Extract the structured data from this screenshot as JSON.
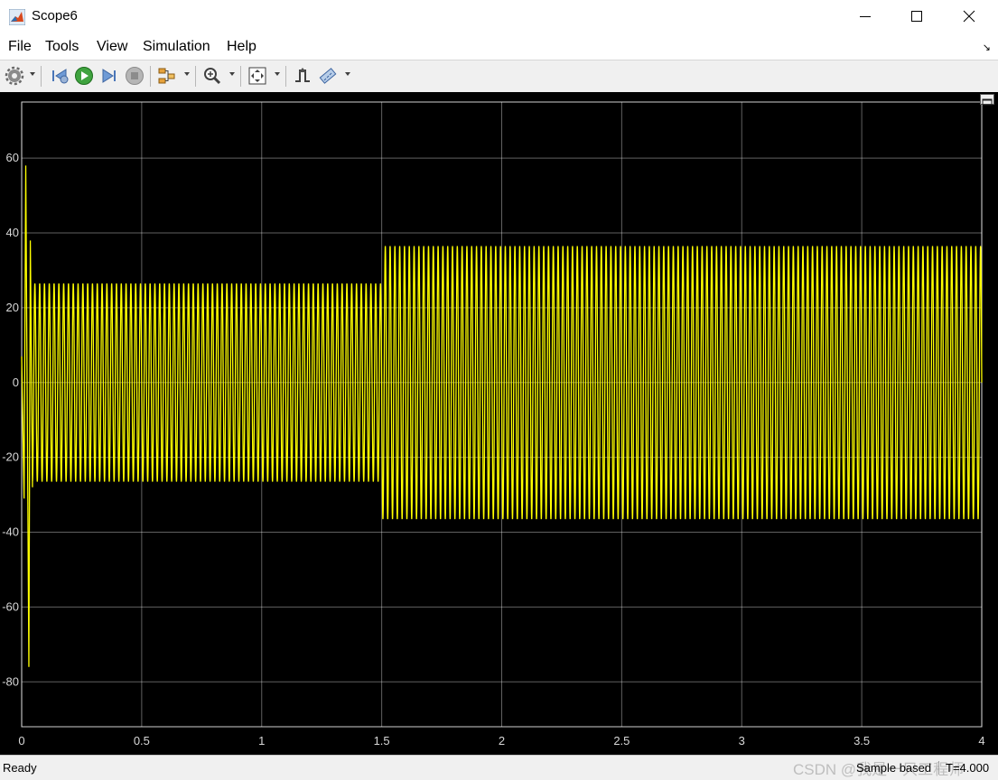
{
  "window": {
    "title": "Scope6"
  },
  "menu": [
    "File",
    "Tools",
    "View",
    "Simulation",
    "Help"
  ],
  "toolbar": {
    "icons": [
      "gear-icon",
      "step-back-icon",
      "run-icon",
      "step-forward-icon",
      "stop-icon",
      "signal-selector-icon",
      "zoom-icon",
      "fit-to-view-icon",
      "triggers-icon",
      "measurements-icon"
    ]
  },
  "status": {
    "ready": "Ready",
    "mode": "Sample based",
    "time": "T=4.000"
  },
  "watermark": "CSDN @我是一只工程师",
  "colors": {
    "signal": "#ffff00",
    "background": "#000000",
    "grid": "#ffffff"
  },
  "chart_data": {
    "type": "line",
    "title": "",
    "xlabel": "",
    "ylabel": "",
    "xlim": [
      0,
      4
    ],
    "ylim": [
      -92,
      75
    ],
    "grid": true,
    "xticks": [
      "0",
      "0.5",
      "1",
      "1.5",
      "2",
      "2.5",
      "3",
      "3.5",
      "4"
    ],
    "yticks": [
      "60",
      "40",
      "20",
      "0",
      "-20",
      "-40",
      "-60",
      "-80"
    ],
    "series": [
      {
        "name": "",
        "frequency_hz": 50,
        "transient": [
          {
            "t": 0.0,
            "v": 7
          },
          {
            "t": 0.01,
            "v": -31
          },
          {
            "t": 0.017,
            "v": 58
          },
          {
            "t": 0.03,
            "v": -76
          },
          {
            "t": 0.036,
            "v": 38
          },
          {
            "t": 0.045,
            "v": -28
          }
        ],
        "segments": [
          {
            "t_start": 0.045,
            "t_end": 1.5,
            "amplitude": 26.5
          },
          {
            "t_start": 1.5,
            "t_end": 4.0,
            "amplitude": 36.5
          }
        ]
      }
    ]
  }
}
